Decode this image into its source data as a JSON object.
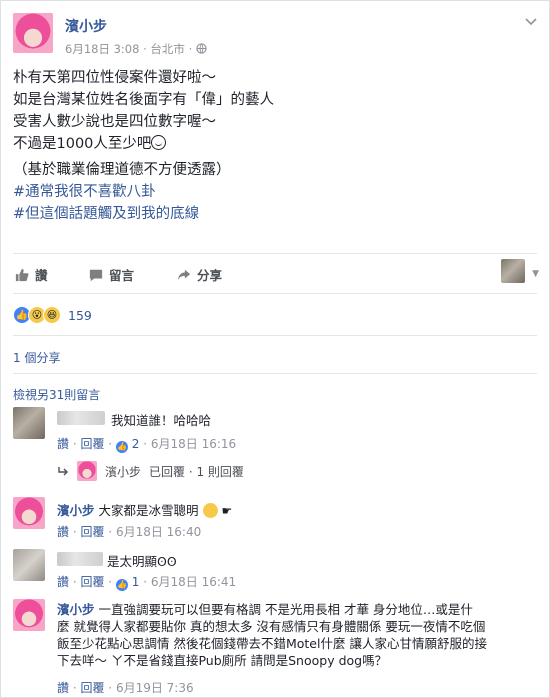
{
  "post": {
    "author": "濱小步",
    "date": "6月18日 3:08",
    "location": "台北市",
    "lines": [
      "朴有天第四位性侵案件還好啦～",
      "如是台灣某位姓名後面字有「偉」的藝人",
      "受害人數少說也是四位數字喔～",
      "不過是1000人至少吧"
    ],
    "note": "（基於職業倫理道德不方便透露）",
    "hashtags": [
      "#通常我很不喜歡八卦",
      "#但這個話題觸及到我的底線"
    ]
  },
  "actions": {
    "like": "讚",
    "comment": "留言",
    "share": "分享"
  },
  "reactions": {
    "count": "159",
    "types": [
      "like-icon",
      "wow-icon",
      "haha-icon"
    ]
  },
  "shares_text": "1 個分享",
  "view_more": "檢視另31則留言",
  "comments": [
    {
      "text": "我知道誰！哈哈哈",
      "like": "讚",
      "reply": "回覆",
      "likes": "2",
      "time": "6月18日 16:16",
      "reply_summary": {
        "name": "濱小步",
        "text": "已回覆 · 1 則回覆"
      }
    },
    {
      "author": "濱小步",
      "text": "大家都是冰雪聰明",
      "like": "讚",
      "reply": "回覆",
      "time": "6月18日 16:40"
    },
    {
      "text": "是太明顯",
      "like": "讚",
      "reply": "回覆",
      "likes": "1",
      "time": "6月18日 16:41"
    },
    {
      "author": "濱小步",
      "lines": [
        "一直強調要玩可以但要有格調 不是光用長相 才華 身分地位…或是什",
        "麼 就覺得人家都要貼你 真的想太多 沒有感情只有身體關係 要玩一夜情不吃個",
        "飯至少花點心思調情 然後花個錢帶去不錯Motel什麼 讓人家心甘情願舒服的接",
        "下去咩～ ㄚ不是省錢直接Pub廁所 請問是Snoopy dog嗎？"
      ],
      "like": "讚",
      "reply": "回覆",
      "time": "6月19日 7:36"
    }
  ]
}
